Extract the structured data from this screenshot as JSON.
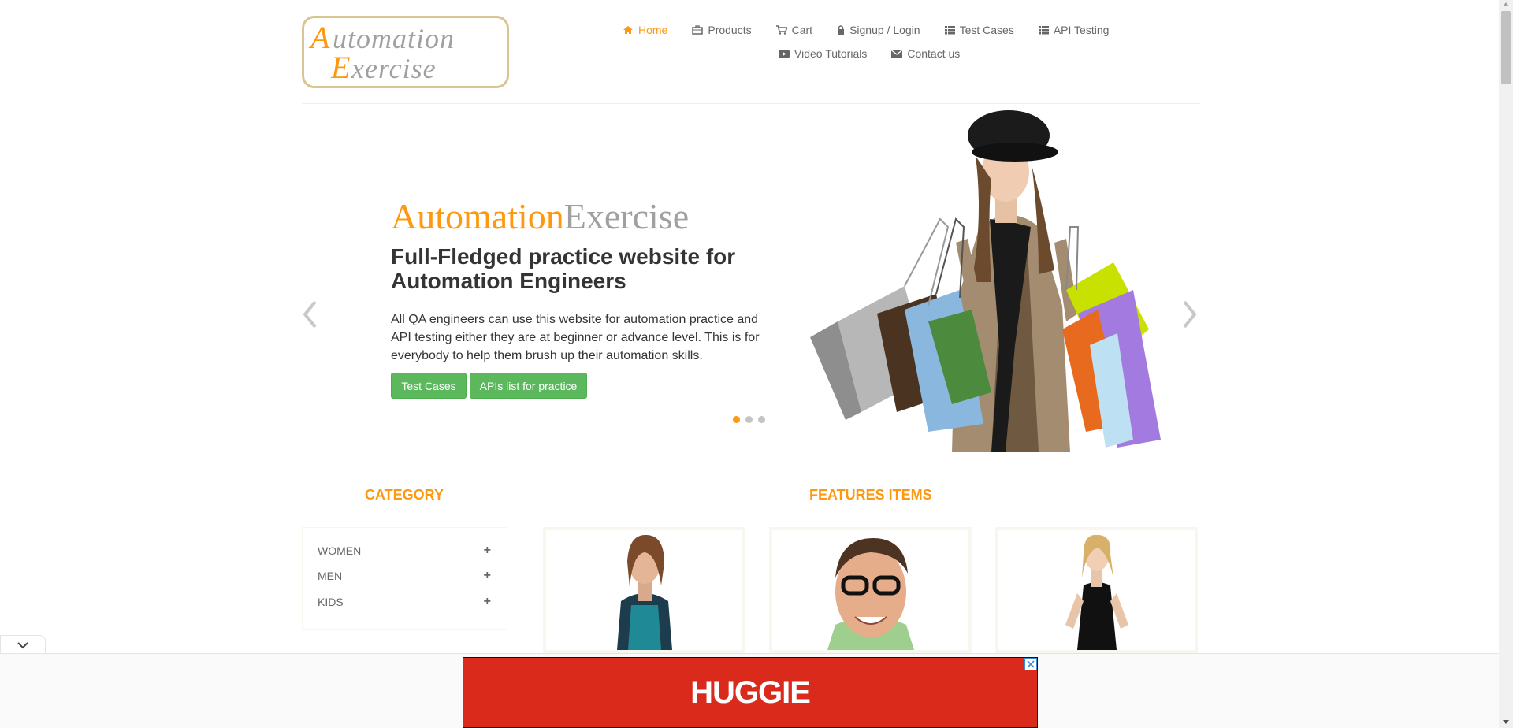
{
  "logo": {
    "text_line1": "Automation",
    "text_line2": "Exercise"
  },
  "nav": {
    "items": [
      {
        "label": "Home",
        "icon": "home-icon",
        "active": true
      },
      {
        "label": "Products",
        "icon": "briefcase-icon"
      },
      {
        "label": "Cart",
        "icon": "cart-icon"
      },
      {
        "label": "Signup / Login",
        "icon": "lock-icon"
      },
      {
        "label": "Test Cases",
        "icon": "list-icon"
      },
      {
        "label": "API Testing",
        "icon": "list-icon"
      },
      {
        "label": "Video Tutorials",
        "icon": "youtube-icon"
      },
      {
        "label": "Contact us",
        "icon": "envelope-icon"
      }
    ]
  },
  "hero": {
    "brand_part1": "Automation",
    "brand_part2": "Exercise",
    "heading": "Full-Fledged practice website for Automation Engineers",
    "text": "All QA engineers can use this website for automation practice and API testing either they are at beginner or advance level. This is for everybody to help them brush up their automation skills.",
    "btn_test_cases": "Test Cases",
    "btn_apis": "APIs list for practice",
    "slide_count": 3,
    "active_slide": 1
  },
  "category": {
    "title": "Category",
    "items": [
      {
        "label": "WOMEN"
      },
      {
        "label": "MEN"
      },
      {
        "label": "KIDS"
      }
    ]
  },
  "features": {
    "title": "Features Items"
  },
  "ad": {
    "text": "HUGGIE"
  },
  "colors": {
    "accent": "#fe980f",
    "button_green": "#5cb85c",
    "ad_red": "#d92a1c"
  }
}
